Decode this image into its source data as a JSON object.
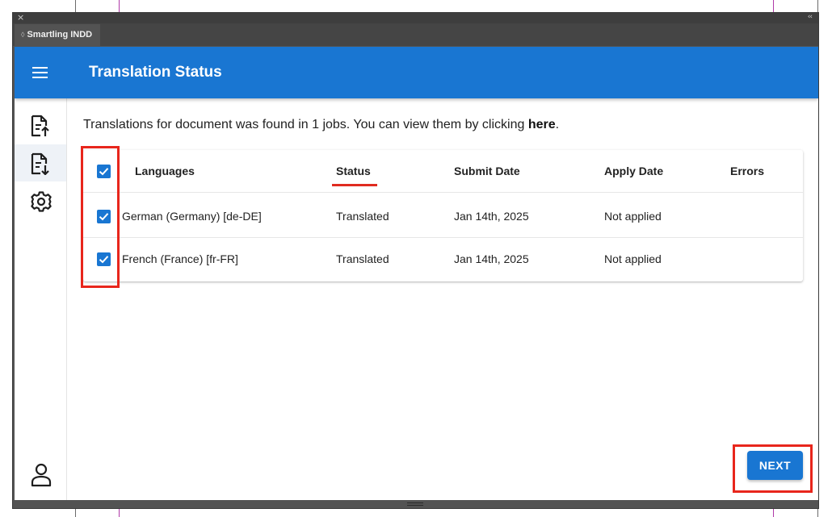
{
  "panel": {
    "close_glyph": "×",
    "collapse_glyph": "‹‹",
    "tab_grip": "◊",
    "tab_label": "Smartling INDD"
  },
  "appbar": {
    "title": "Translation Status",
    "menu_icon": "hamburger-menu-icon",
    "color": "#1976d2"
  },
  "sidebar": {
    "items": [
      {
        "icon": "document-upload-icon",
        "active": false
      },
      {
        "icon": "document-download-icon",
        "active": true
      },
      {
        "icon": "gear-icon",
        "active": false
      }
    ],
    "bottom_icon": "user-icon"
  },
  "main": {
    "intro_text": "Translations for document was found in 1 jobs. You can view them by clicking ",
    "intro_link": "here",
    "intro_end": ".",
    "table": {
      "columns": [
        "Languages",
        "Status",
        "Submit Date",
        "Apply Date",
        "Errors"
      ],
      "header_checked": true,
      "rows": [
        {
          "checked": true,
          "language": "German (Germany) [de-DE]",
          "status": "Translated",
          "submit_date": "Jan 14th, 2025",
          "apply_date": "Not applied",
          "errors": ""
        },
        {
          "checked": true,
          "language": "French (France) [fr-FR]",
          "status": "Translated",
          "submit_date": "Jan 14th, 2025",
          "apply_date": "Not applied",
          "errors": ""
        }
      ]
    },
    "next_label": "NEXT"
  },
  "colors": {
    "accent": "#1976d2",
    "annotation": "#e8261c",
    "panel_chrome": "#535353"
  }
}
